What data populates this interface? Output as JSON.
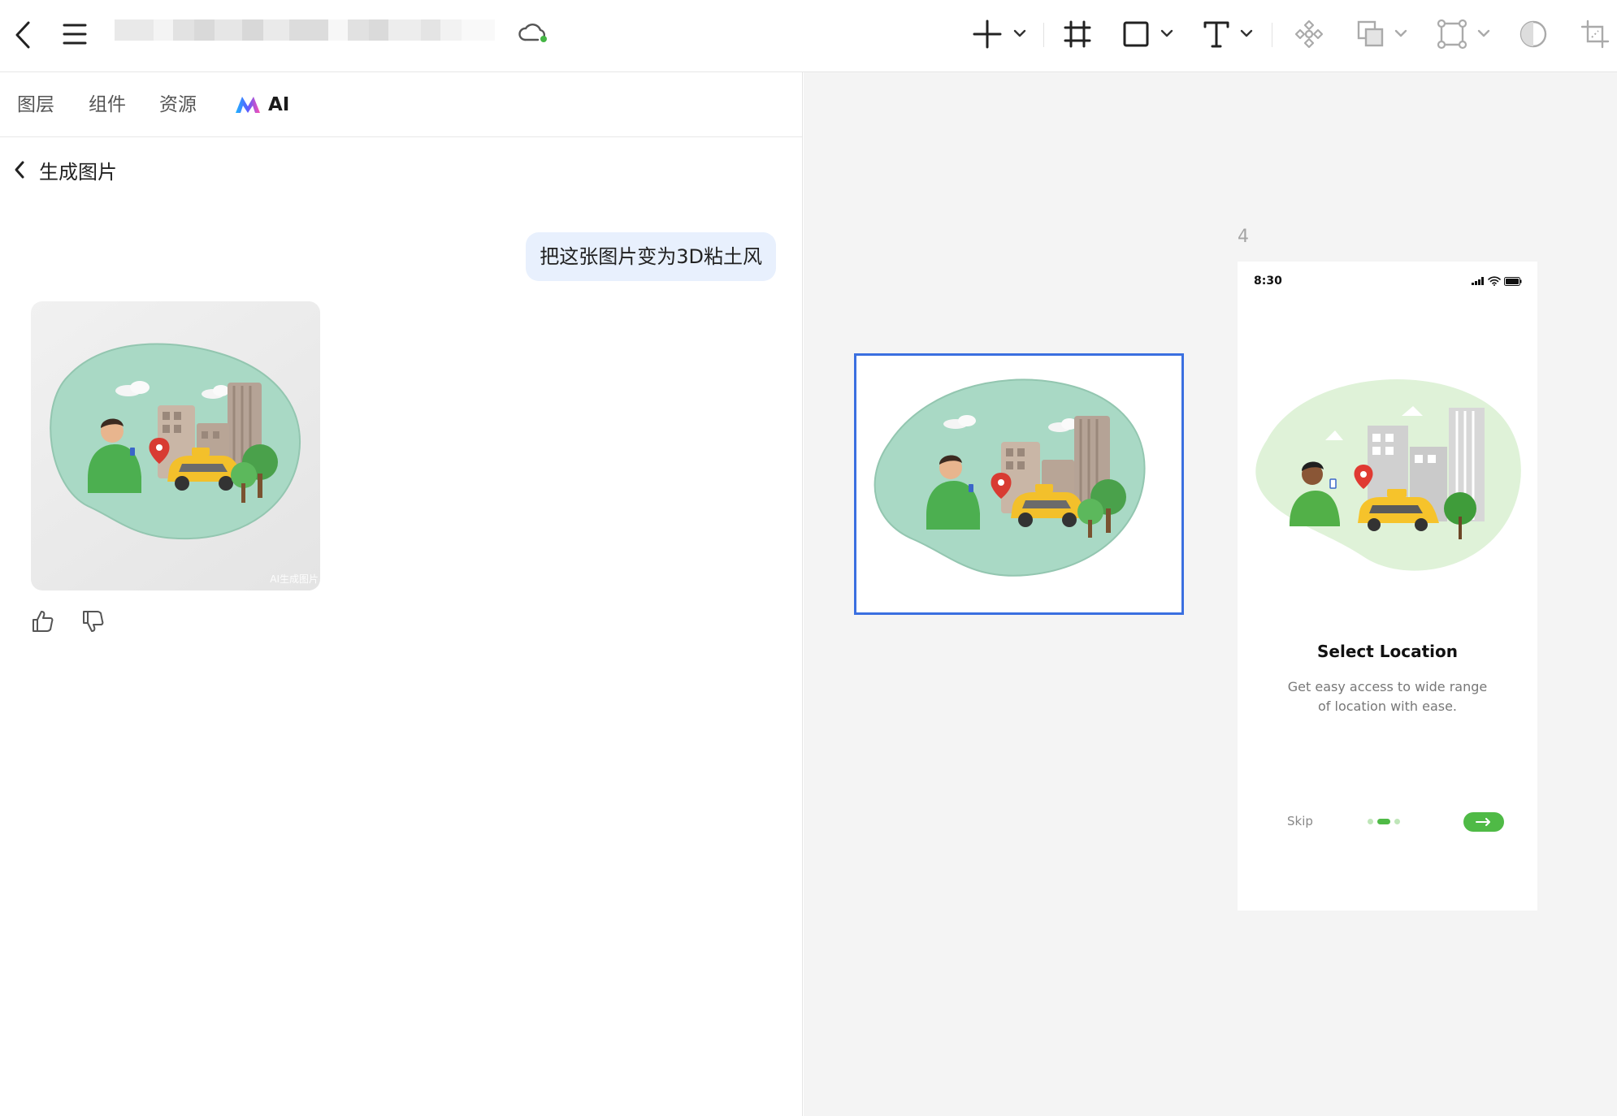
{
  "toolbar": {
    "doc_title_redacted": true,
    "cloud_status_color": "#44b544",
    "icons": [
      "back-arrow-icon",
      "menu-icon",
      "cloud-sync-icon",
      "plus-icon",
      "frame-icon",
      "rectangle-icon",
      "text-icon",
      "component-icon",
      "boolean-icon",
      "path-icon",
      "contrast-icon",
      "crop-icon"
    ]
  },
  "left_panel": {
    "tabs": [
      {
        "label": "图层"
      },
      {
        "label": "组件"
      },
      {
        "label": "资源"
      },
      {
        "label": "AI"
      }
    ],
    "subpage_title": "生成图片",
    "chat": {
      "user_message": "把这张图片变为3D粘土风",
      "result_watermark": "AI生成图片"
    }
  },
  "canvas": {
    "frame_label": "4",
    "selection_color": "#3a6fe0",
    "phone": {
      "time": "8:30",
      "title": "Select Location",
      "description": "Get easy access to wide range of location with ease.",
      "skip_label": "Skip",
      "accent_color": "#4fba46",
      "pager": {
        "count": 3,
        "active": 2
      }
    }
  }
}
